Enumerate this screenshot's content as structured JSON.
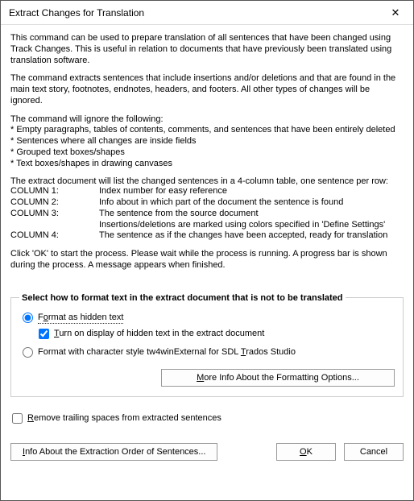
{
  "window": {
    "title": "Extract Changes for Translation",
    "close_glyph": "✕"
  },
  "intro": {
    "p1": "This command can be used to prepare translation of all sentences that have been changed using Track Changes. This is useful in relation to documents that have previously been translated using translation software.",
    "p2": "The command extracts sentences that include insertions and/or deletions and that are found in the main text story, footnotes, endnotes, headers, and footers. All other types of changes will be ignored.",
    "ignore_title": "The command will ignore the following:",
    "ignore_1": "* Empty paragraphs, tables of contents, comments, and sentences that have been entirely deleted",
    "ignore_2": "* Sentences where all changes are inside fields",
    "ignore_3": "* Grouped text boxes/shapes",
    "ignore_4": "* Text boxes/shapes in drawing canvases",
    "columns_intro": "The extract document will list the changed sentences in a 4-column table, one sentence per row:",
    "col1_key": "COLUMN 1:",
    "col1_val": "Index number for easy reference",
    "col2_key": "COLUMN 2:",
    "col2_val": "Info about in which part of the document the sentence is found",
    "col3_key": "COLUMN 3:",
    "col3_val": "The sentence from the source document",
    "col3_val2": "Insertions/deletions are marked using colors specified in 'Define Settings'",
    "col4_key": "COLUMN 4:",
    "col4_val": "The sentence as if the changes have been accepted, ready for translation",
    "ok_hint": "Click 'OK' to start the process. Please wait while the process is running. A progress bar is shown during the process. A message appears when finished."
  },
  "group": {
    "legend": "Select how to format text in the extract document that is not to be translated",
    "opt_hidden_pre": "F",
    "opt_hidden_key": "o",
    "opt_hidden_post": "rmat as hidden text",
    "sub_hidden_key": "T",
    "sub_hidden_post": "urn on display of hidden text in the extract document",
    "opt_style_pre": "Format with character style tw4winExternal for SDL ",
    "opt_style_key": "T",
    "opt_style_post": "rados Studio",
    "more_info_key": "M",
    "more_info_post": "ore Info About the Formatting Options..."
  },
  "remove": {
    "key": "R",
    "post": "emove trailing spaces from extracted sentences"
  },
  "buttons": {
    "info_key": "I",
    "info_post": "nfo About the Extraction Order of Sentences...",
    "ok_key": "O",
    "ok_post": "K",
    "cancel": "Cancel"
  }
}
